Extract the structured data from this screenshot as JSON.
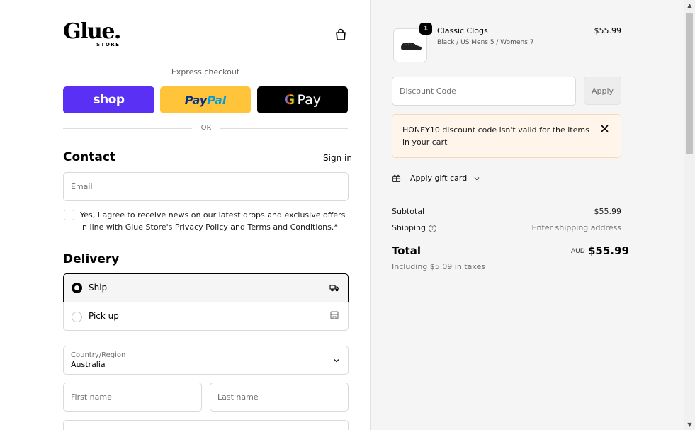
{
  "logo": {
    "name": "Glue.",
    "sub": "STORE"
  },
  "express": {
    "label": "Express checkout",
    "shop": "shop",
    "paypal_a": "Pay",
    "paypal_b": "Pal",
    "gpay": "Pay",
    "gpay_g": "G"
  },
  "divider": "OR",
  "contact": {
    "title": "Contact",
    "signin": "Sign in",
    "email_placeholder": "Email",
    "consent": "Yes, I agree to receive news on our latest drops and exclusive offers in line with Glue Store's Privacy Policy and Terms and Conditions.*"
  },
  "delivery": {
    "title": "Delivery",
    "options": [
      {
        "label": "Ship",
        "selected": true,
        "icon": "truck-icon"
      },
      {
        "label": "Pick up",
        "selected": false,
        "icon": "store-icon"
      }
    ],
    "country_label": "Country/Region",
    "country_value": "Australia",
    "first_name_placeholder": "First name",
    "last_name_placeholder": "Last name"
  },
  "cart": {
    "item": {
      "name": "Classic Clogs",
      "variant": "Black / US Mens 5 / Womens 7",
      "price": "$55.99",
      "quantity": "1"
    },
    "discount_placeholder": "Discount Code",
    "apply": "Apply",
    "alert": "HONEY10 discount code isn't valid for the items in your cart",
    "gift_card": "Apply gift card",
    "subtotal_label": "Subtotal",
    "subtotal_value": "$55.99",
    "shipping_label": "Shipping",
    "shipping_value": "Enter shipping address",
    "total_label": "Total",
    "total_currency": "AUD",
    "total_value": "$55.99",
    "taxes": "Including $5.09 in taxes"
  },
  "colors": {
    "shop": "#5a31f4",
    "paypal": "#ffc439",
    "gpay": "#000000",
    "alert_bg": "#fff5ea"
  }
}
